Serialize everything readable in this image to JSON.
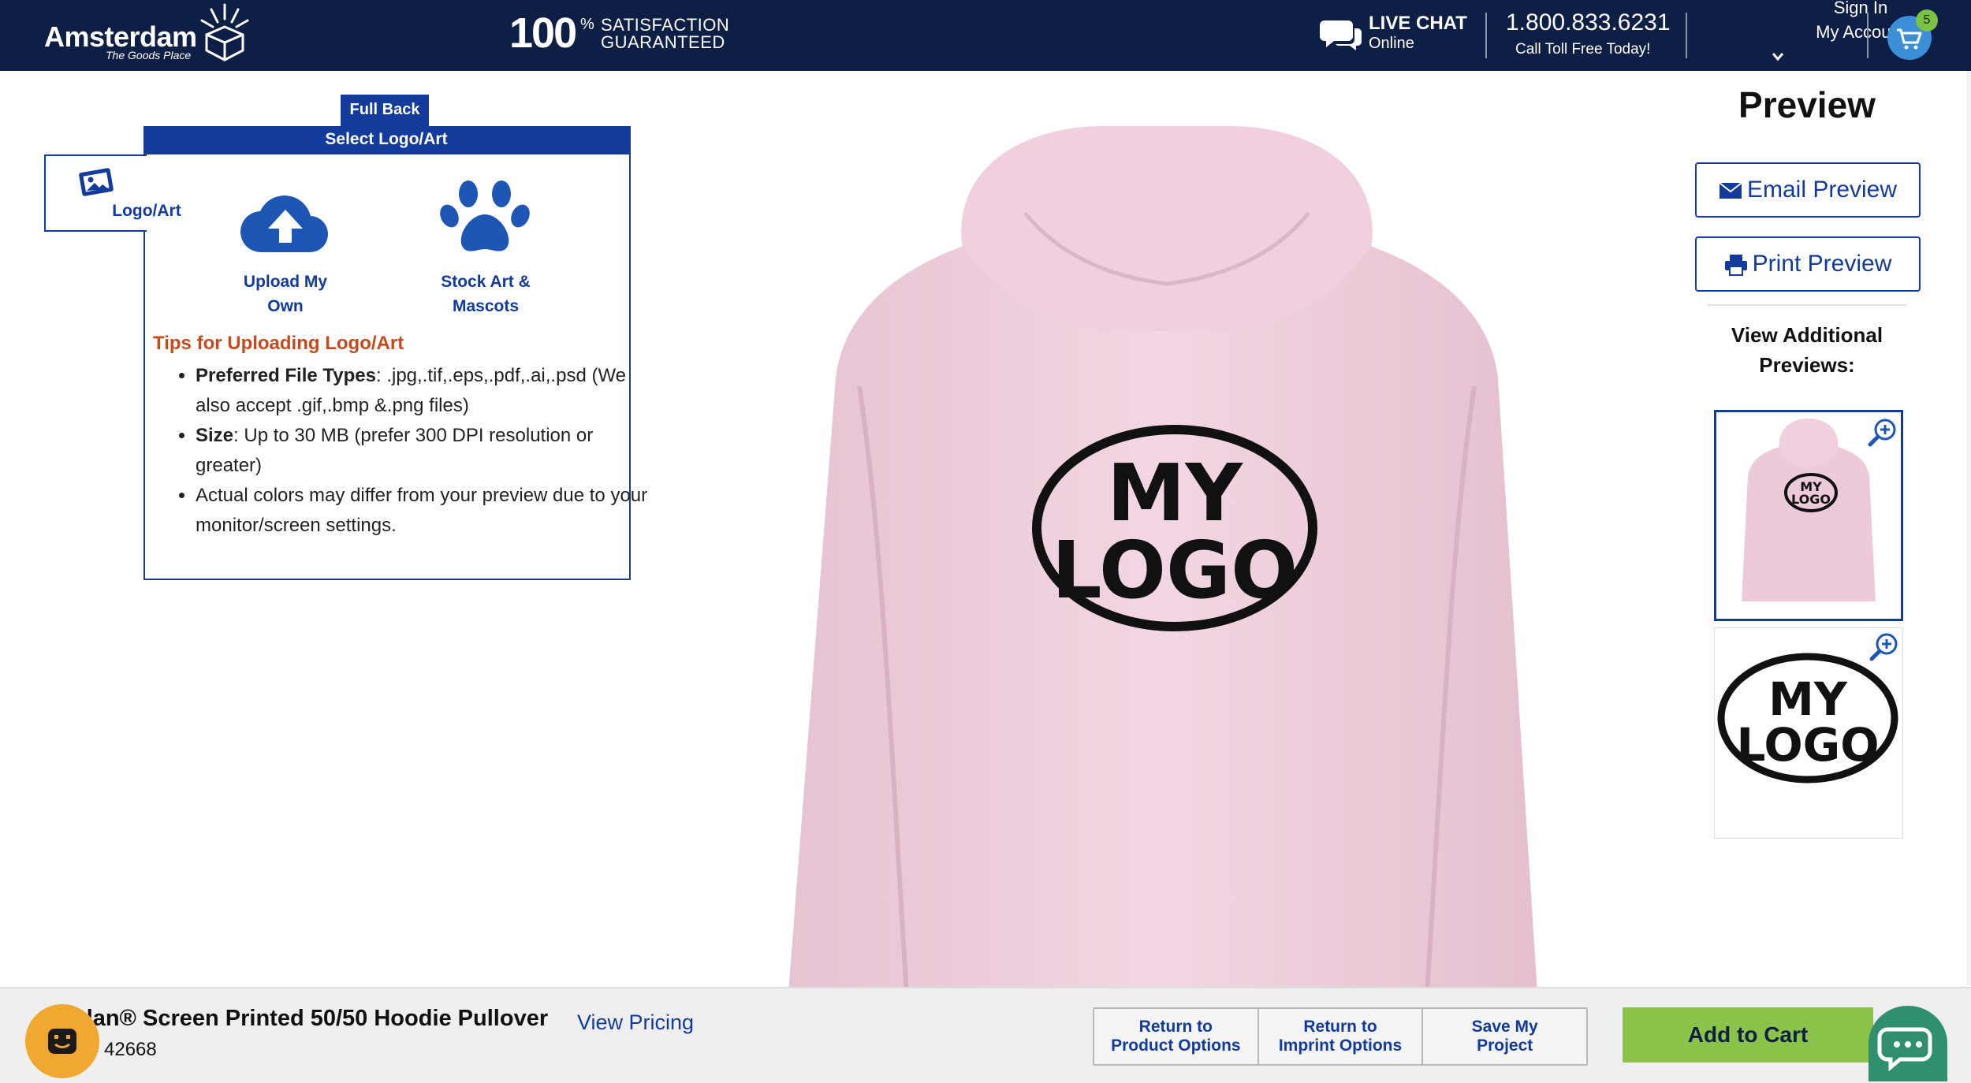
{
  "header": {
    "brand_name": "Amsterdam",
    "brand_tagline": "The Goods Place",
    "guarantee_number": "100",
    "guarantee_percent": "%",
    "guarantee_line1": "SATISFACTION",
    "guarantee_line2": "GUARANTEED",
    "chat_title": "LIVE CHAT",
    "chat_status": "Online",
    "phone": "1.800.833.6231",
    "phone_sub": "Call Toll Free Today!",
    "account_line1": "Sign In",
    "account_line2": "My Account",
    "cart_count": "5",
    "bg_color": "#0e1f45"
  },
  "designer": {
    "location_tab": "Full Back",
    "panel_title": "Select Logo/Art",
    "side_tab_label": "Logo/Art",
    "options": [
      {
        "label_line1": "Upload My",
        "label_line2": "Own",
        "icon": "upload-cloud-icon"
      },
      {
        "label_line1": "Stock Art &",
        "label_line2": "Mascots",
        "icon": "paw-icon"
      }
    ],
    "tips_title": "Tips for Uploading Logo/Art",
    "tips": [
      {
        "bold": "Preferred File Types",
        "text": ": .jpg,.tif,.eps,.pdf,.ai,.psd (We also accept .gif,.bmp &.png files)"
      },
      {
        "bold": "Size",
        "text": ": Up to 30 MB (prefer 300 DPI resolution or greater)"
      },
      {
        "bold": "",
        "text": "Actual colors may differ from your preview due to your monitor/screen settings."
      }
    ],
    "accent_color": "#123b9c",
    "tips_color": "#c54a1c"
  },
  "product_preview": {
    "logo_line1": "MY",
    "logo_line2": "LOGO",
    "garment_color": "#f2d3e0"
  },
  "preview_panel": {
    "title": "Preview",
    "email_button": "Email Preview",
    "print_button": "Print Preview",
    "additional_title_line1": "View Additional",
    "additional_title_line2": "Previews:",
    "thumb_logo_line1": "MY",
    "thumb_logo_line2": "LOGO"
  },
  "footer": {
    "product_name": "dan® Screen Printed 50/50 Hoodie Pullover",
    "sku": "# 42668",
    "view_pricing": "View Pricing",
    "return_product_l1": "Return to",
    "return_product_l2": "Product Options",
    "return_imprint_l1": "Return to",
    "return_imprint_l2": "Imprint Options",
    "save_l1": "Save My",
    "save_l2": "Project",
    "add_to_cart": "Add to Cart",
    "add_to_cart_color": "#8bc34a"
  }
}
